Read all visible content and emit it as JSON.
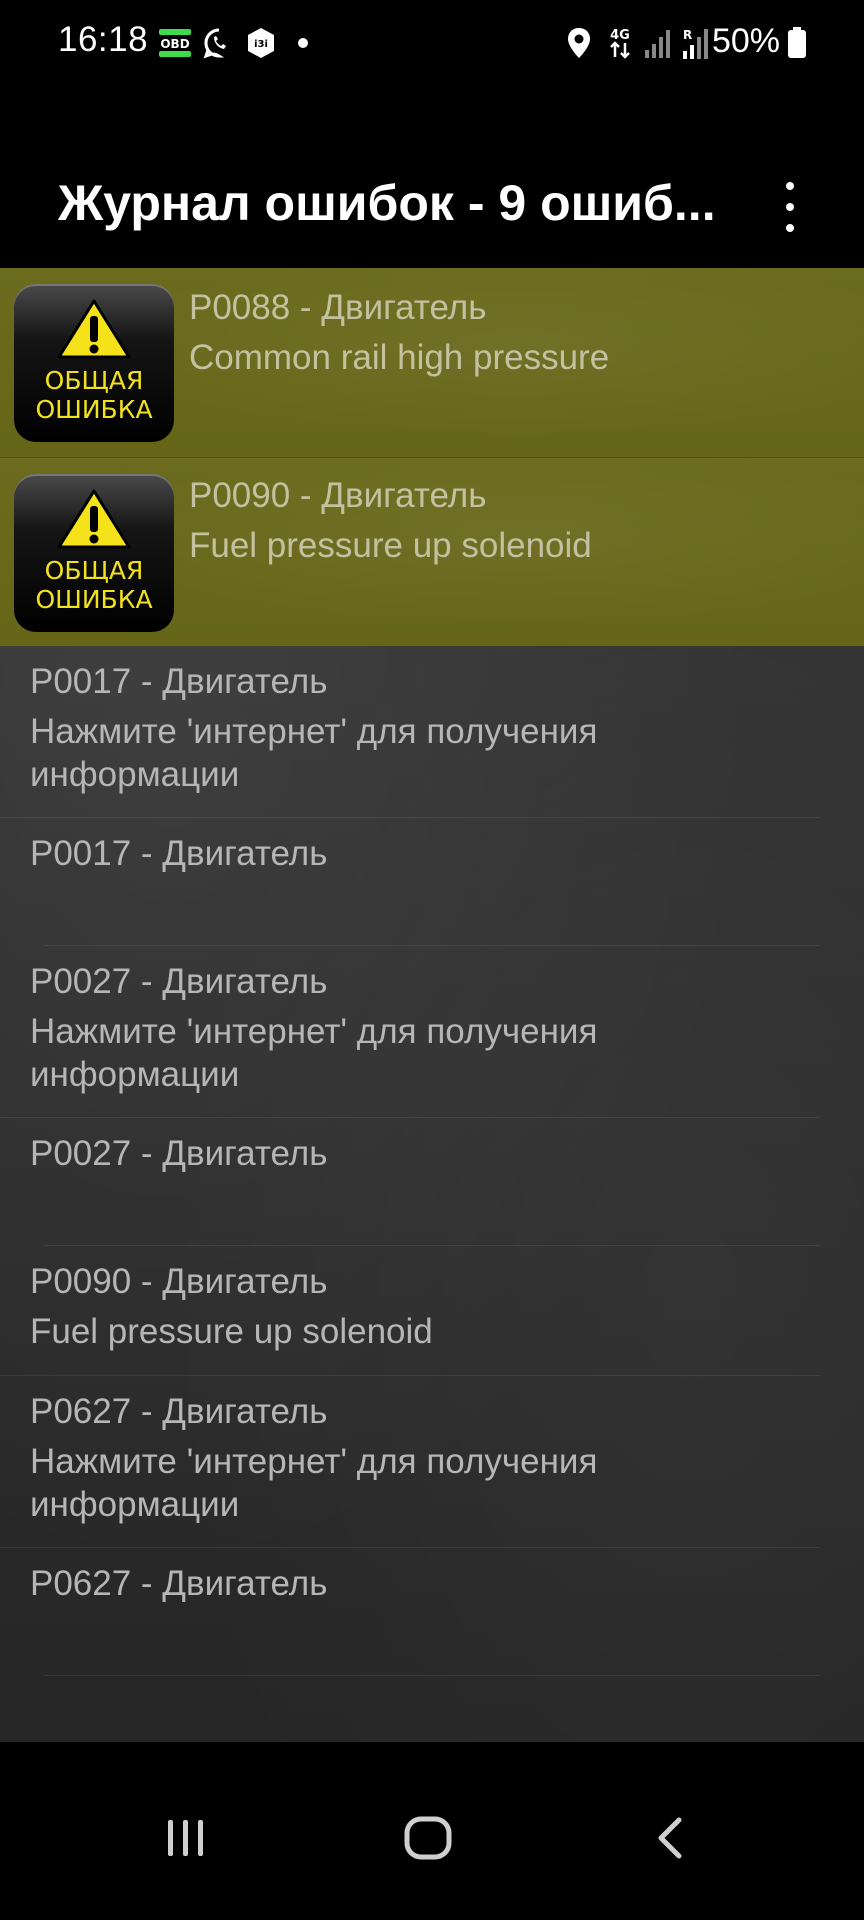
{
  "status_bar": {
    "time": "16:18",
    "battery_percent": "50%",
    "notification_icons": [
      "obd-icon",
      "whatsapp-icon",
      "app-icon",
      "dot-icon"
    ],
    "system_icons": [
      "location-icon",
      "4g-data-icon",
      "signal-icon",
      "roaming-signal-icon",
      "battery-icon"
    ],
    "network_label": "4G"
  },
  "app_bar": {
    "title": "Журнал ошибок - 9 ошиб...",
    "menu_icon": "more-vert-icon"
  },
  "badge": {
    "line1": "ОБЩАЯ",
    "line2": "ОШИБКА"
  },
  "errors": [
    {
      "code": "P0088 - Двигатель",
      "desc": "Common rail high pressure",
      "highlight": true
    },
    {
      "code": "P0090 - Двигатель",
      "desc": "Fuel pressure up solenoid",
      "highlight": true
    },
    {
      "code": "P0017 - Двигатель",
      "desc": "Нажмите 'интернет' для получения информации",
      "highlight": false
    },
    {
      "code": "P0017 - Двигатель",
      "desc": "",
      "highlight": false
    },
    {
      "code": "P0027 - Двигатель",
      "desc": "Нажмите 'интернет' для получения информации",
      "highlight": false
    },
    {
      "code": "P0027 - Двигатель",
      "desc": "",
      "highlight": false
    },
    {
      "code": "P0090 - Двигатель",
      "desc": "Fuel pressure up solenoid",
      "highlight": false
    },
    {
      "code": "P0627 - Двигатель",
      "desc": "Нажмите 'интернет' для получения информации",
      "highlight": false
    },
    {
      "code": "P0627 - Двигатель",
      "desc": "",
      "highlight": false
    }
  ],
  "nav_bar": {
    "buttons": [
      "recent-apps-icon",
      "home-icon",
      "back-icon"
    ]
  }
}
